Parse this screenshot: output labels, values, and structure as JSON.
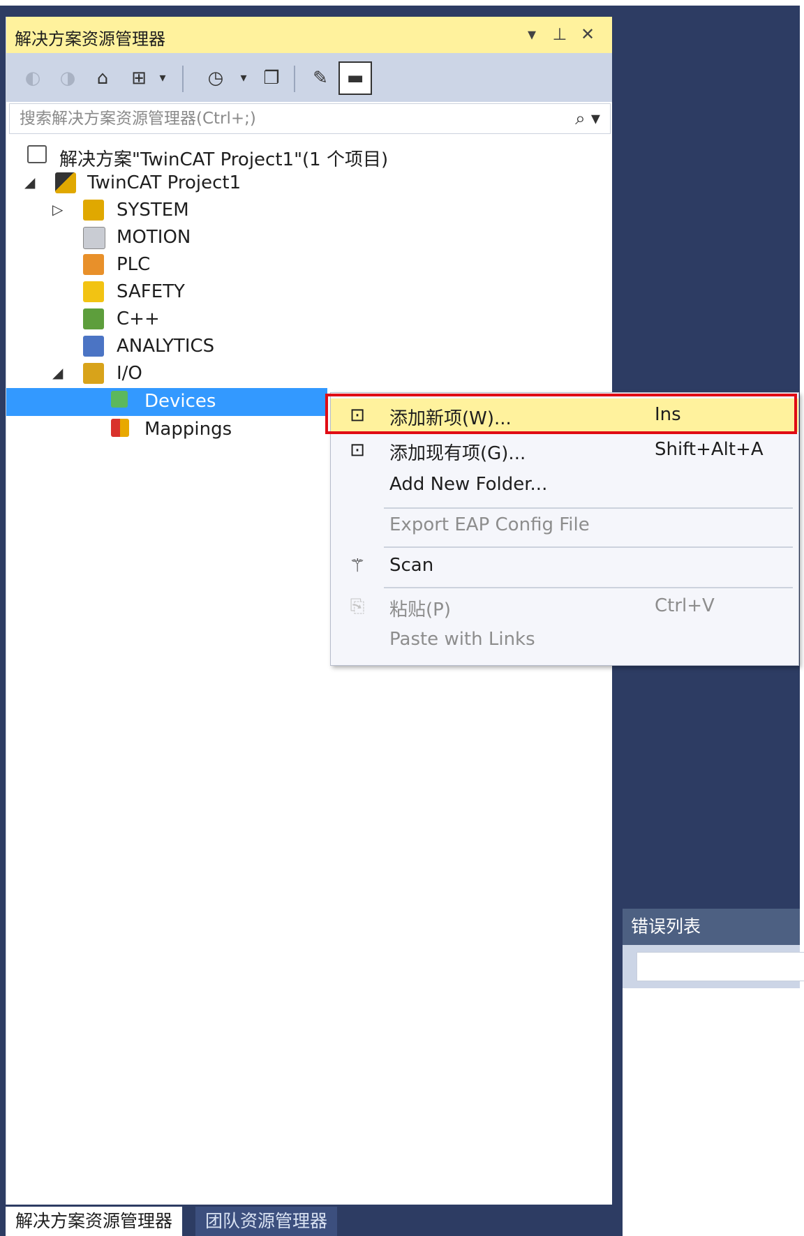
{
  "solution_explorer": {
    "title": "解决方案资源管理器",
    "title_buttons": {
      "dropdown": "▾",
      "pin": "⊥",
      "close": "✕"
    },
    "search_placeholder": "搜索解决方案资源管理器(Ctrl+;)",
    "tree": [
      {
        "label": "解决方案\"TwinCAT Project1\"(1 个项目)",
        "icon": "solution-icon"
      },
      {
        "label": "TwinCAT Project1",
        "icon": "project-icon",
        "expanded": true
      },
      {
        "label": "SYSTEM",
        "icon": "system-icon",
        "collapsed": true
      },
      {
        "label": "MOTION",
        "icon": "motion-icon"
      },
      {
        "label": "PLC",
        "icon": "plc-icon"
      },
      {
        "label": "SAFETY",
        "icon": "safety-icon"
      },
      {
        "label": "C++",
        "icon": "cpp-icon"
      },
      {
        "label": "ANALYTICS",
        "icon": "analytics-icon"
      },
      {
        "label": "I/O",
        "icon": "io-icon",
        "expanded": true
      },
      {
        "label": "Devices",
        "icon": "devices-icon",
        "selected": true
      },
      {
        "label": "Mappings",
        "icon": "mappings-icon"
      }
    ]
  },
  "context_menu": {
    "items": [
      {
        "label": "添加新项(W)...",
        "shortcut": "Ins",
        "icon": "add-new-item-icon",
        "highlighted": true
      },
      {
        "label": "添加现有项(G)...",
        "shortcut": "Shift+Alt+A",
        "icon": "add-existing-item-icon"
      },
      {
        "label": "Add New Folder..."
      },
      {
        "label": "Export EAP Config File",
        "disabled": true
      },
      {
        "label": "Scan",
        "icon": "scan-wand-icon"
      },
      {
        "label": "粘贴(P)",
        "shortcut": "Ctrl+V",
        "icon": "paste-icon",
        "disabled": true
      },
      {
        "label": "Paste with Links",
        "disabled": true
      }
    ]
  },
  "bottom_tabs": {
    "active": "解决方案资源管理器",
    "inactive": "团队资源管理器"
  },
  "error_list": {
    "title": "错误列表"
  },
  "colors": {
    "accent_yellow": "#fff29d",
    "selection_blue": "#3399ff",
    "highlight_red": "#e00c14",
    "dark_bg": "#2d3c63"
  }
}
